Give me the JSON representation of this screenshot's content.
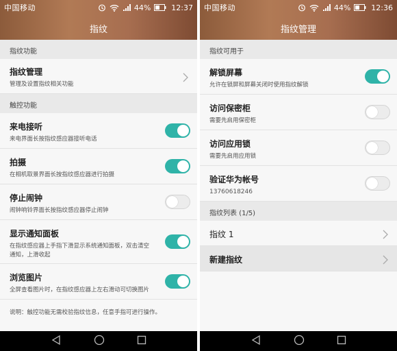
{
  "colors": {
    "accent": "#2fb3a8",
    "header_start": "#8c5b3b",
    "header_end": "#7e4b33"
  },
  "left": {
    "status": {
      "carrier": "中国移动",
      "battery": "44%",
      "time": "12:37"
    },
    "title": "指纹",
    "section1": "指纹功能",
    "manage": {
      "title": "指纹管理",
      "sub": "管理及设置指纹相关功能"
    },
    "section2": "触控功能",
    "items": [
      {
        "title": "来电接听",
        "sub": "来电界面长按指纹感应器接听电话",
        "on": true
      },
      {
        "title": "拍摄",
        "sub": "在相机取景界面长按指纹感应器进行拍摄",
        "on": true
      },
      {
        "title": "停止闹钟",
        "sub": "闹钟响铃界面长按指纹感应器停止闹钟",
        "on": false
      },
      {
        "title": "显示通知面板",
        "sub": "在指纹感应器上手指下滑显示系统通知面板，双击清空通知，上滑收起",
        "on": true
      },
      {
        "title": "浏览图片",
        "sub": "全屏查看图片时，在指纹感应器上左右滑动可切换图片",
        "on": true
      }
    ],
    "note": "说明：触控功能无需校验指纹信息，任意手指可进行操作。"
  },
  "right": {
    "status": {
      "carrier": "中国移动",
      "battery": "44%",
      "time": "12:36"
    },
    "title": "指纹管理",
    "section1": "指纹可用于",
    "items": [
      {
        "title": "解锁屏幕",
        "sub": "允许在锁屏和屏幕关闭时使用指纹解锁",
        "on": true
      },
      {
        "title": "访问保密柜",
        "sub": "需要先启用保密柜",
        "on": false
      },
      {
        "title": "访问应用锁",
        "sub": "需要先启用应用锁",
        "on": false
      },
      {
        "title": "验证华为帐号",
        "sub": "13760618246",
        "on": false
      }
    ],
    "section2": "指纹列表 (1/5)",
    "fingerprints": [
      {
        "label": "指纹 1"
      }
    ],
    "new_fingerprint": "新建指纹"
  },
  "icons": {
    "status": [
      "alarm-icon",
      "wifi-icon",
      "signal-icon",
      "battery-icon"
    ],
    "nav": [
      "back-icon",
      "home-icon",
      "recents-icon"
    ]
  }
}
